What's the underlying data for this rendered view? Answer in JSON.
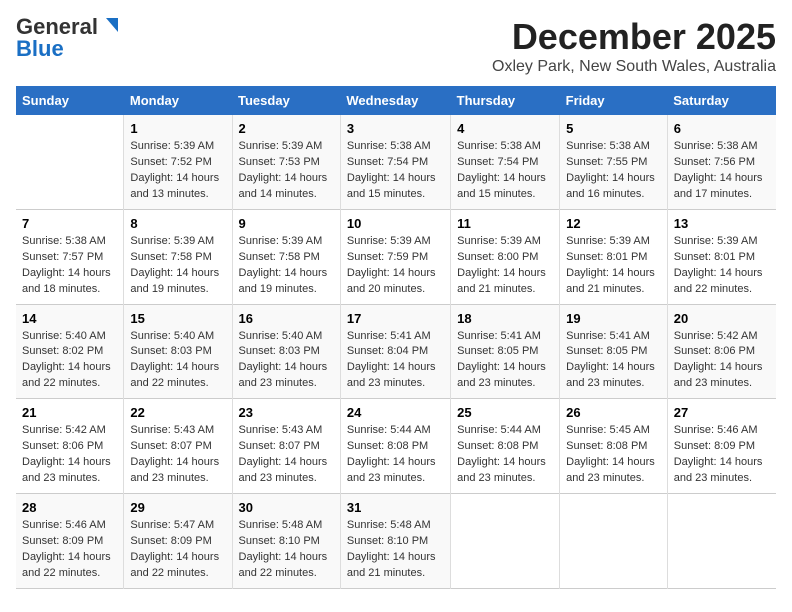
{
  "header": {
    "logo_general": "General",
    "logo_blue": "Blue",
    "month": "December 2025",
    "location": "Oxley Park, New South Wales, Australia"
  },
  "days_of_week": [
    "Sunday",
    "Monday",
    "Tuesday",
    "Wednesday",
    "Thursday",
    "Friday",
    "Saturday"
  ],
  "weeks": [
    [
      {
        "day": "",
        "info": ""
      },
      {
        "day": "1",
        "info": "Sunrise: 5:39 AM\nSunset: 7:52 PM\nDaylight: 14 hours\nand 13 minutes."
      },
      {
        "day": "2",
        "info": "Sunrise: 5:39 AM\nSunset: 7:53 PM\nDaylight: 14 hours\nand 14 minutes."
      },
      {
        "day": "3",
        "info": "Sunrise: 5:38 AM\nSunset: 7:54 PM\nDaylight: 14 hours\nand 15 minutes."
      },
      {
        "day": "4",
        "info": "Sunrise: 5:38 AM\nSunset: 7:54 PM\nDaylight: 14 hours\nand 15 minutes."
      },
      {
        "day": "5",
        "info": "Sunrise: 5:38 AM\nSunset: 7:55 PM\nDaylight: 14 hours\nand 16 minutes."
      },
      {
        "day": "6",
        "info": "Sunrise: 5:38 AM\nSunset: 7:56 PM\nDaylight: 14 hours\nand 17 minutes."
      }
    ],
    [
      {
        "day": "7",
        "info": "Sunrise: 5:38 AM\nSunset: 7:57 PM\nDaylight: 14 hours\nand 18 minutes."
      },
      {
        "day": "8",
        "info": "Sunrise: 5:39 AM\nSunset: 7:58 PM\nDaylight: 14 hours\nand 19 minutes."
      },
      {
        "day": "9",
        "info": "Sunrise: 5:39 AM\nSunset: 7:58 PM\nDaylight: 14 hours\nand 19 minutes."
      },
      {
        "day": "10",
        "info": "Sunrise: 5:39 AM\nSunset: 7:59 PM\nDaylight: 14 hours\nand 20 minutes."
      },
      {
        "day": "11",
        "info": "Sunrise: 5:39 AM\nSunset: 8:00 PM\nDaylight: 14 hours\nand 21 minutes."
      },
      {
        "day": "12",
        "info": "Sunrise: 5:39 AM\nSunset: 8:01 PM\nDaylight: 14 hours\nand 21 minutes."
      },
      {
        "day": "13",
        "info": "Sunrise: 5:39 AM\nSunset: 8:01 PM\nDaylight: 14 hours\nand 22 minutes."
      }
    ],
    [
      {
        "day": "14",
        "info": "Sunrise: 5:40 AM\nSunset: 8:02 PM\nDaylight: 14 hours\nand 22 minutes."
      },
      {
        "day": "15",
        "info": "Sunrise: 5:40 AM\nSunset: 8:03 PM\nDaylight: 14 hours\nand 22 minutes."
      },
      {
        "day": "16",
        "info": "Sunrise: 5:40 AM\nSunset: 8:03 PM\nDaylight: 14 hours\nand 23 minutes."
      },
      {
        "day": "17",
        "info": "Sunrise: 5:41 AM\nSunset: 8:04 PM\nDaylight: 14 hours\nand 23 minutes."
      },
      {
        "day": "18",
        "info": "Sunrise: 5:41 AM\nSunset: 8:05 PM\nDaylight: 14 hours\nand 23 minutes."
      },
      {
        "day": "19",
        "info": "Sunrise: 5:41 AM\nSunset: 8:05 PM\nDaylight: 14 hours\nand 23 minutes."
      },
      {
        "day": "20",
        "info": "Sunrise: 5:42 AM\nSunset: 8:06 PM\nDaylight: 14 hours\nand 23 minutes."
      }
    ],
    [
      {
        "day": "21",
        "info": "Sunrise: 5:42 AM\nSunset: 8:06 PM\nDaylight: 14 hours\nand 23 minutes."
      },
      {
        "day": "22",
        "info": "Sunrise: 5:43 AM\nSunset: 8:07 PM\nDaylight: 14 hours\nand 23 minutes."
      },
      {
        "day": "23",
        "info": "Sunrise: 5:43 AM\nSunset: 8:07 PM\nDaylight: 14 hours\nand 23 minutes."
      },
      {
        "day": "24",
        "info": "Sunrise: 5:44 AM\nSunset: 8:08 PM\nDaylight: 14 hours\nand 23 minutes."
      },
      {
        "day": "25",
        "info": "Sunrise: 5:44 AM\nSunset: 8:08 PM\nDaylight: 14 hours\nand 23 minutes."
      },
      {
        "day": "26",
        "info": "Sunrise: 5:45 AM\nSunset: 8:08 PM\nDaylight: 14 hours\nand 23 minutes."
      },
      {
        "day": "27",
        "info": "Sunrise: 5:46 AM\nSunset: 8:09 PM\nDaylight: 14 hours\nand 23 minutes."
      }
    ],
    [
      {
        "day": "28",
        "info": "Sunrise: 5:46 AM\nSunset: 8:09 PM\nDaylight: 14 hours\nand 22 minutes."
      },
      {
        "day": "29",
        "info": "Sunrise: 5:47 AM\nSunset: 8:09 PM\nDaylight: 14 hours\nand 22 minutes."
      },
      {
        "day": "30",
        "info": "Sunrise: 5:48 AM\nSunset: 8:10 PM\nDaylight: 14 hours\nand 22 minutes."
      },
      {
        "day": "31",
        "info": "Sunrise: 5:48 AM\nSunset: 8:10 PM\nDaylight: 14 hours\nand 21 minutes."
      },
      {
        "day": "",
        "info": ""
      },
      {
        "day": "",
        "info": ""
      },
      {
        "day": "",
        "info": ""
      }
    ]
  ]
}
